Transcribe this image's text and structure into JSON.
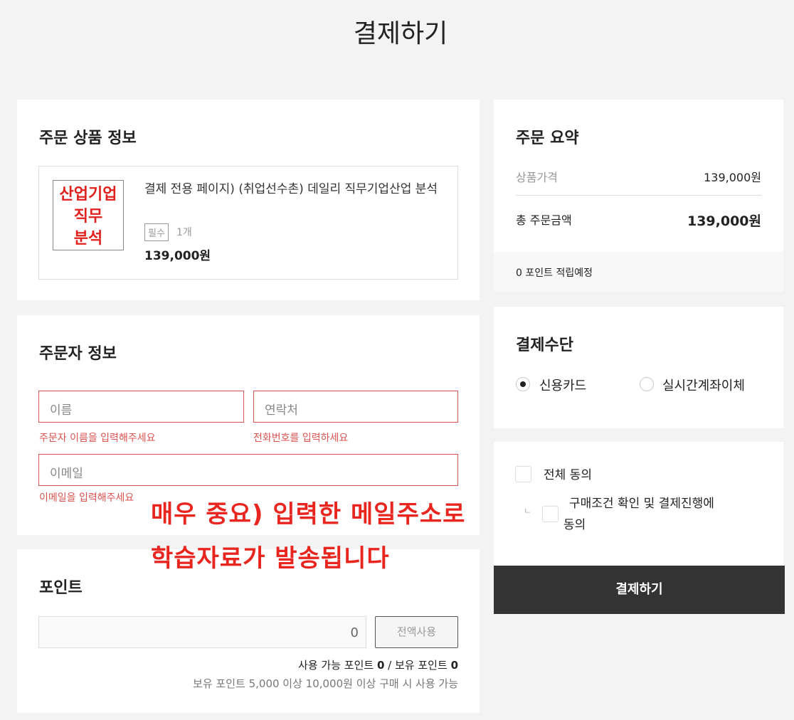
{
  "page": {
    "title": "결제하기"
  },
  "order": {
    "heading": "주문 상품 정보",
    "thumb_lines": [
      "산업기업",
      "직무",
      "분석"
    ],
    "product_name": "결제 전용 페이지) (취업선수촌) 데일리 직무기업산업 분석",
    "tag": "필수",
    "qty": "1개",
    "price": "139,000원"
  },
  "orderer": {
    "heading": "주문자 정보",
    "name_placeholder": "이름",
    "phone_placeholder": "연락처",
    "email_placeholder": "이메일",
    "name_error": "주문자 이름을 입력해주세요",
    "phone_error": "전화번호를 입력하세요",
    "email_error": "이메일을 입력해주세요"
  },
  "notice": {
    "line1": "매우 중요) 입력한 메일주소로",
    "line2": "학습자료가 발송됩니다"
  },
  "points": {
    "heading": "포인트",
    "value": "0",
    "use_all": "전액사용",
    "avail_label": "사용 가능 포인트",
    "avail": "0",
    "sep": " / ",
    "own_label": "보유 포인트",
    "own": "0",
    "rule": "보유 포인트 5,000 이상 10,000원 이상 구매 시 사용 가능"
  },
  "summary": {
    "heading": "주문 요약",
    "price_label": "상품가격",
    "price": "139,000원",
    "total_label": "총 주문금액",
    "total": "139,000원",
    "points_note": "0 포인트 적립예정"
  },
  "payment": {
    "heading": "결제수단",
    "options": [
      "신용카드",
      "실시간계좌이체"
    ]
  },
  "agree": {
    "all": "전체 동의",
    "sub_line1": "구매조건 확인 및 결제진행에",
    "sub_line2": "동의",
    "branch": "ㄴ"
  },
  "actions": {
    "pay": "결제하기"
  }
}
